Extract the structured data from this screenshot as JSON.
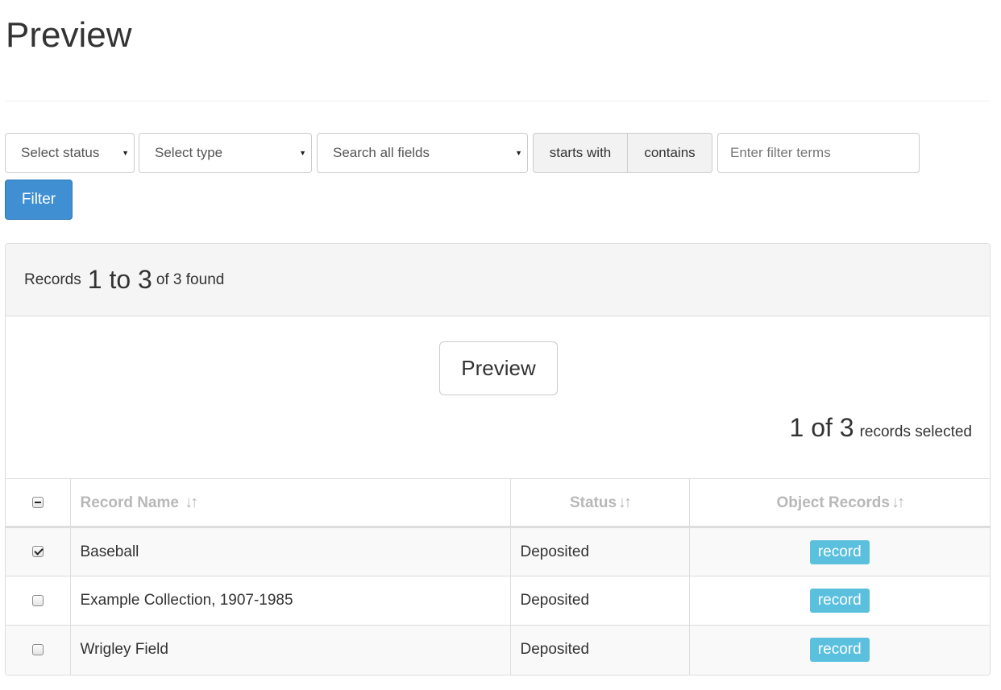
{
  "page": {
    "title": "Preview"
  },
  "filters": {
    "status_select": "Select status",
    "type_select": "Select type",
    "field_select": "Search all fields",
    "match_starts_with": "starts with",
    "match_contains": "contains",
    "terms_placeholder": "Enter filter terms",
    "filter_button": "Filter"
  },
  "results": {
    "prefix": "Records",
    "range": "1 to 3",
    "suffix": "of 3 found",
    "preview_button": "Preview",
    "selected_count": "1 of 3",
    "selected_suffix": "records selected"
  },
  "table": {
    "headers": {
      "name": "Record Name",
      "status": "Status",
      "objects": "Object Records"
    },
    "rows": [
      {
        "checked": true,
        "name": "Baseball",
        "status": "Deposited",
        "objects": "record"
      },
      {
        "checked": false,
        "name": "Example Collection, 1907-1985",
        "status": "Deposited",
        "objects": "record"
      },
      {
        "checked": false,
        "name": "Wrigley Field",
        "status": "Deposited",
        "objects": "record"
      }
    ]
  },
  "colors": {
    "primary": "#3f8fd2",
    "label_info": "#5bc0de",
    "panel_heading_bg": "#f5f5f5"
  },
  "icons": {
    "sort": "sort-icon",
    "select_caret": "caret-down-icon"
  }
}
